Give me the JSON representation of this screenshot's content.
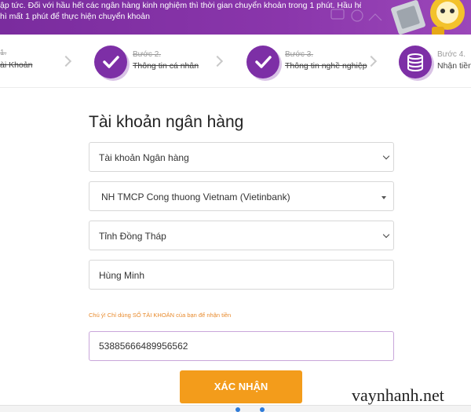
{
  "banner": {
    "line1": "ập tức. Đối với hầu hết các ngân hàng kinh nghiệm thì thời gian chuyển khoản trong 1 phút. Hầu hết",
    "line2": "hì mất 1 phút để thực hiện chuyển khoản"
  },
  "steps": [
    {
      "label": "1.",
      "title": "ài Khoản",
      "icon": "check-icon"
    },
    {
      "label": "Bước 2.",
      "title": "Thông tin cá nhân",
      "icon": "check-icon"
    },
    {
      "label": "Bước 3.",
      "title": "Thông tin nghề nghiệp",
      "icon": "check-icon"
    },
    {
      "label": "Bước 4.",
      "title": "Nhận tiền",
      "icon": "coins-icon"
    }
  ],
  "form": {
    "title": "Tài khoản ngân hàng",
    "account_type": "Tài khoản Ngân hàng",
    "bank": "NH TMCP Cong thuong Vietnam (Vietinbank)",
    "province": "Tỉnh Đồng Tháp",
    "branch": "Hùng Minh",
    "note": "Chú ý! Chỉ dùng SỐ TÀI KHOẢN của bạn để nhận tiền",
    "account_number": "53885666489956562",
    "submit_label": "XÁC NHẬN"
  },
  "watermark": "vaynhanh.net",
  "colors": {
    "brand_purple": "#7d2fa6",
    "accent_orange": "#f39c1b",
    "note_orange": "#e88a2c"
  }
}
